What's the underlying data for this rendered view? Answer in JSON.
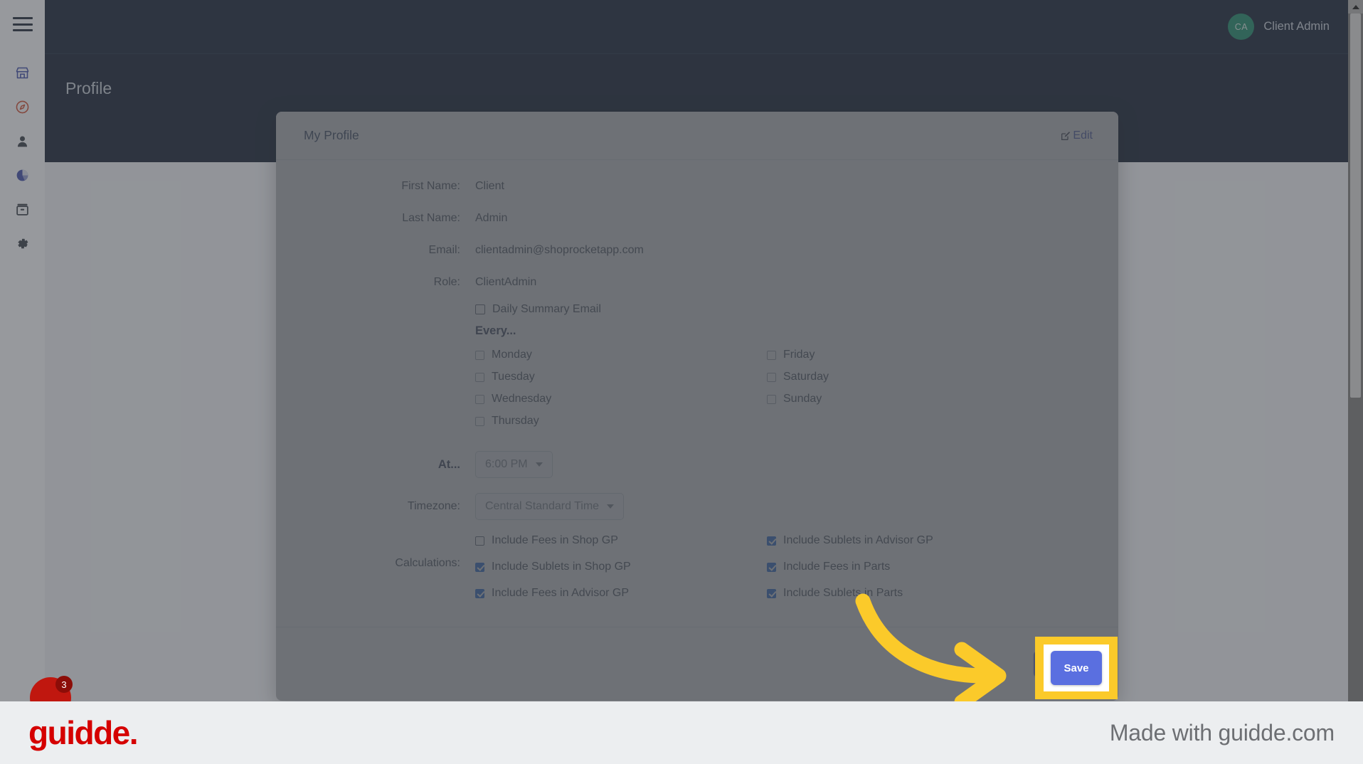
{
  "topbar": {
    "avatar_initials": "CA",
    "user_name": "Client Admin"
  },
  "page": {
    "title": "Profile"
  },
  "sidebar": {
    "menu_icon": "hamburger-icon",
    "items": [
      {
        "icon": "store-icon",
        "color": "#3b4aa8"
      },
      {
        "icon": "compass-icon",
        "color": "#d4492b"
      },
      {
        "icon": "person-icon",
        "color": "#343a40"
      },
      {
        "icon": "pie-chart-icon",
        "color": "#3b4aa8"
      },
      {
        "icon": "archive-icon",
        "color": "#343a40"
      },
      {
        "icon": "gear-icon",
        "color": "#343a40"
      }
    ]
  },
  "modal": {
    "title": "My Profile",
    "edit_label": "Edit",
    "fields": [
      {
        "label": "First Name:",
        "value": "Client"
      },
      {
        "label": "Last Name:",
        "value": "Admin"
      },
      {
        "label": "Email:",
        "value": "clientadmin@shoprocketapp.com"
      },
      {
        "label": "Role:",
        "value": "ClientAdmin"
      }
    ],
    "daily_summary": {
      "label": "Daily Summary Email",
      "checked": false
    },
    "every_label": "Every...",
    "days": {
      "left": [
        {
          "label": "Monday",
          "checked": false
        },
        {
          "label": "Tuesday",
          "checked": false
        },
        {
          "label": "Wednesday",
          "checked": false
        },
        {
          "label": "Thursday",
          "checked": false
        }
      ],
      "right": [
        {
          "label": "Friday",
          "checked": false
        },
        {
          "label": "Saturday",
          "checked": false
        },
        {
          "label": "Sunday",
          "checked": false
        }
      ]
    },
    "at": {
      "label": "At...",
      "value": "6:00 PM"
    },
    "timezone": {
      "label": "Timezone:",
      "value": "Central Standard Time"
    },
    "calculations": {
      "label": "Calculations:",
      "left": [
        {
          "label": "Include Fees in Shop GP",
          "checked": false
        },
        {
          "label": "Include Sublets in Shop GP",
          "checked": true
        },
        {
          "label": "Include Fees in Advisor GP",
          "checked": true
        }
      ],
      "right": [
        {
          "label": "Include Sublets in Advisor GP",
          "checked": true
        },
        {
          "label": "Include Fees in Parts",
          "checked": true
        },
        {
          "label": "Include Sublets in Parts",
          "checked": true
        }
      ]
    },
    "save_label": "Save"
  },
  "annotation": {
    "highlight_color": "#FBCA2A",
    "arrow_color": "#FBCA2A",
    "save_label": "Save"
  },
  "chat": {
    "badge_count": "3",
    "color": "#c0170f"
  },
  "brandbar": {
    "logo": "guidde.",
    "made_with": "Made with guidde.com",
    "logo_color": "#d50000"
  }
}
